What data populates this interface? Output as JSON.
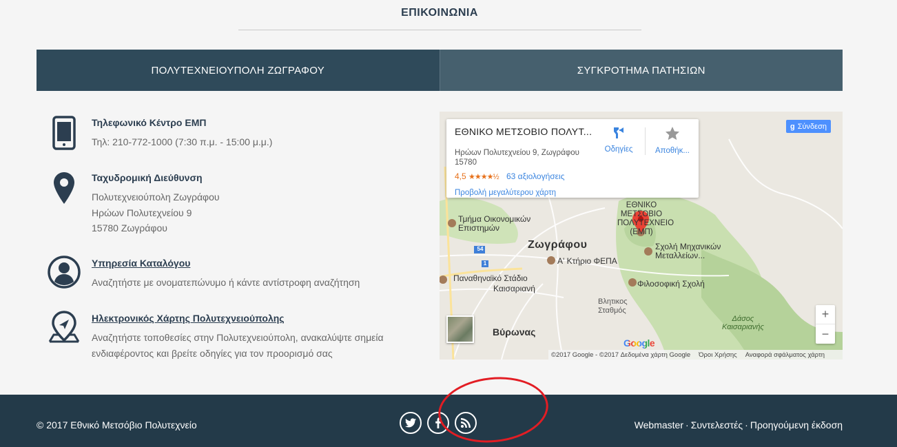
{
  "section": {
    "title": "ΕΠΙΚΟΙΝΩΝΙΑ"
  },
  "tabs": [
    {
      "label": "ΠΟΛΥΤΕΧΝΕΙΟΥΠΟΛΗ ΖΩΓΡΑΦΟΥ",
      "active": true
    },
    {
      "label": "ΣΥΓΚΡΟΤΗΜΑ ΠΑΤΗΣΙΩΝ",
      "active": false
    }
  ],
  "contacts": {
    "phone": {
      "heading": "Τηλεφωνικό Κέντρο ΕΜΠ",
      "lines": [
        "Τηλ: 210-772-1000 (7:30 π.μ. - 15:00 μ.μ.)"
      ],
      "icon": "mobile-phone-icon"
    },
    "address": {
      "heading": "Ταχυδρομική Διεύθυνση",
      "lines": [
        "Πολυτεχνειούπολη Ζωγράφου",
        "Ηρώων Πολυτεχνείου 9",
        "15780 Ζωγράφου"
      ],
      "icon": "map-pin-icon"
    },
    "directory": {
      "heading": "Υπηρεσία Καταλόγου",
      "lines": [
        "Αναζητήστε με ονοματεπώνυμο ή κάντε αντίστροφη αναζήτηση"
      ],
      "icon": "user-circle-icon"
    },
    "campus_map": {
      "heading": "Ηλεκτρονικός Χάρτης Πολυτεχνειούπολης",
      "lines": [
        "Αναζητήστε τοποθεσίες στην Πολυτεχνειούπολη, ανακαλύψτε σημεία",
        "ενδιαφέροντος και βρείτε οδηγίες για τον προορισμό σας"
      ],
      "icon": "map-navigation-icon"
    }
  },
  "map": {
    "place_name": "ΕΘΝΙΚΟ ΜΕΤΣΟΒΙΟ ΠΟΛΥΤ...",
    "address": "Ηρώων Πολυτεχνείου 9, Ζωγράφου 15780",
    "rating": "4,5",
    "stars": "★★★★½",
    "reviews": "63 αξιολογήσεις",
    "larger_map": "Προβολή μεγαλύτερου χάρτη",
    "directions": "Οδηγίες",
    "save": "Αποθήκ...",
    "signin": "Σύνδεση",
    "zoom_in": "+",
    "zoom_out": "−",
    "attribution": "©2017 Google - ©2017 Δεδομένα χάρτη Google",
    "terms": "Όροι Χρήσης",
    "report": "Αναφορά σφάλματος χάρτη",
    "labels": {
      "zografou": "Ζωγράφου",
      "school_econ_1": "Τμήμα Οικονομικών",
      "school_econ_2": "Επιστημών",
      "feba": "Α' Κτήριο ΦΕΠΑ",
      "stadium_1": "Παναθηναϊκό Στάδιο",
      "stadium_2": "Καισαριανή",
      "mining_1": "Σχολή Μηχανικών",
      "mining_2": "Μεταλλείων...",
      "philosophy": "Φιλοσοφική Σχολή",
      "vlitikos_1": "Βλητικος",
      "vlitikos_2": "Σταθμός",
      "vyronas": "Βύρωνας",
      "forest_1": "Δάσος",
      "forest_2": "Καισαριανής",
      "ntua_1": "ΕΘΝΙΚΟ",
      "ntua_2": "ΜΕΤΣΟΒΙΟ",
      "ntua_3": "ΠΟΛΥΤΕΧΝΕΙΟ",
      "ntua_4": "(ΕΜΠ)",
      "road_54": "54",
      "road_1": "1",
      "google": "Google"
    }
  },
  "footer": {
    "copyright": "© 2017 Εθνικό Μετσόβιο Πολυτεχνείο",
    "links": [
      "Webmaster",
      "Συντελεστές",
      "Προηγούμενη έκδοση"
    ],
    "separator": "·",
    "socials": [
      "twitter-icon",
      "facebook-icon",
      "rss-icon"
    ]
  },
  "colors": {
    "dark_navy": "#233a49",
    "tab_active": "#2f4a5a",
    "tab_inactive": "#46606e",
    "annotation": "#e21d24"
  }
}
